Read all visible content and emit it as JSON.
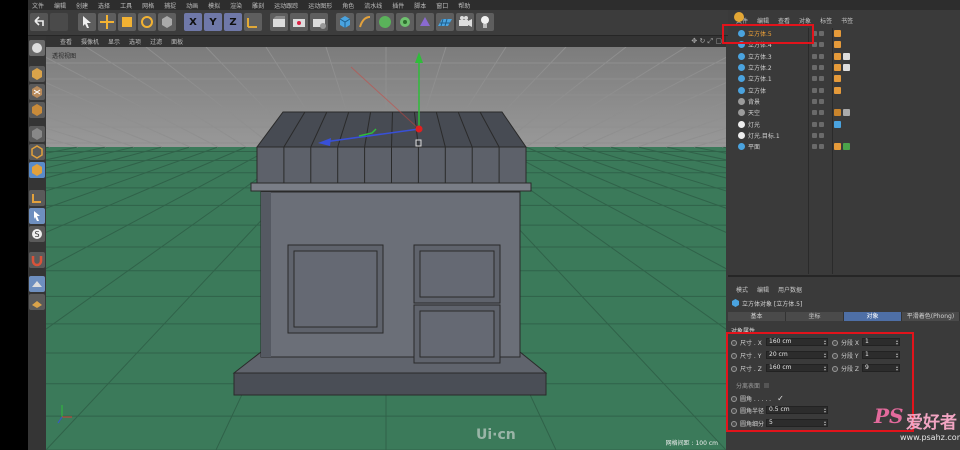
{
  "menubar": [
    "文件",
    "编辑",
    "创建",
    "选择",
    "工具",
    "网格",
    "捕捉",
    "动画",
    "模拟",
    "渲染",
    "雕刻",
    "运动跟踪",
    "运动图形",
    "角色",
    "流水线",
    "插件",
    "脚本",
    "窗口",
    "帮助"
  ],
  "toolbar": {
    "axis_x": "X",
    "axis_y": "Y",
    "axis_z": "Z"
  },
  "viewport": {
    "menu": [
      "查看",
      "摄像机",
      "显示",
      "选项",
      "过滤",
      "面板"
    ],
    "label": "透视视图",
    "grid_spacing": "网格间距 : 100 cm",
    "watermark": "Ui·cn",
    "colors": {
      "floor": "#3b7a5a",
      "sky": "#8a8a8a",
      "model": "#5b5f68",
      "selection": "#e2131b"
    }
  },
  "object_manager": {
    "menu": [
      "文件",
      "编辑",
      "查看",
      "对象",
      "标签",
      "书签"
    ],
    "objects": [
      {
        "name": "立方体.5",
        "selected": true
      },
      {
        "name": "立方体.4"
      },
      {
        "name": "立方体.3"
      },
      {
        "name": "立方体.2"
      },
      {
        "name": "立方体.1"
      },
      {
        "name": "立方体"
      },
      {
        "name": "背景"
      },
      {
        "name": "天空"
      },
      {
        "name": "灯光"
      },
      {
        "name": "灯光.目标.1"
      },
      {
        "name": "平面"
      }
    ]
  },
  "attribute_manager": {
    "menu": [
      "模式",
      "编辑",
      "用户数据"
    ],
    "title": "立方体对象 [立方体.5]",
    "tabs": [
      "基本",
      "坐标",
      "对象",
      "平滑着色(Phong)"
    ],
    "section": "对象属性",
    "size_x_label": "尺寸 . X",
    "size_x_value": "160 cm",
    "size_y_label": "尺寸 . Y",
    "size_y_value": "20 cm",
    "size_z_label": "尺寸 . Z",
    "size_z_value": "160 cm",
    "seg_x_label": "分段 X",
    "seg_x_value": "1",
    "seg_y_label": "分段 Y",
    "seg_y_value": "1",
    "seg_z_label": "分段 Z",
    "seg_z_value": "9",
    "separate_surfaces": "分离表面",
    "fillet_label": "圆角 . . . . .",
    "fillet_check": "✓",
    "fillet_radius_label": "圆角半径",
    "fillet_radius_value": "0.5 cm",
    "fillet_sub_label": "圆角细分",
    "fillet_sub_value": "5"
  },
  "watermark": {
    "ps": "PS",
    "cn": "爱好者",
    "url": "www.psahz.com"
  }
}
